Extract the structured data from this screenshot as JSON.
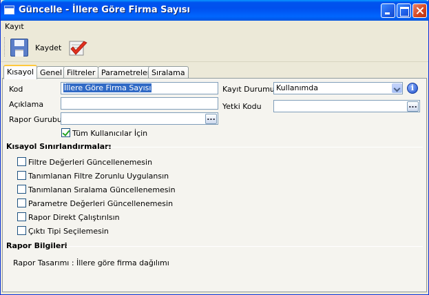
{
  "window": {
    "title": "Güncelle - İllere Göre Firma Sayısı"
  },
  "menu": {
    "items": [
      "Kayıt"
    ]
  },
  "toolbar": {
    "save_label": "Kaydet"
  },
  "tabs": [
    "Kısayol",
    "Genel",
    "Filtreler",
    "Parametreler",
    "Sıralama"
  ],
  "active_tab": "Kısayol",
  "form": {
    "kod_label": "Kod",
    "kod_value": "İllere Göre Firma Sayısı",
    "aciklama_label": "Açıklama",
    "aciklama_value": "",
    "rapor_gurubu_label": "Rapor Gurubu",
    "rapor_gurubu_value": "",
    "tum_kullanicilar_label": "Tüm Kullanıcılar İçin",
    "tum_kullanicilar_checked": true,
    "kayit_durumu_label": "Kayıt Durumu",
    "kayit_durumu_value": "Kullanımda",
    "yetki_kodu_label": "Yetki Kodu",
    "yetki_kodu_value": "",
    "ellipsis": "..."
  },
  "restrictions": {
    "title": "Kısayol Sınırlandırmaları",
    "items": [
      {
        "label": "Filtre Değerleri Güncellenemesin",
        "checked": false
      },
      {
        "label": "Tanımlanan Filtre Zorunlu Uygulansın",
        "checked": false
      },
      {
        "label": "Tanımlanan Sıralama Güncellenemesin",
        "checked": false
      },
      {
        "label": "Parametre Değerleri Güncellenemesin",
        "checked": false
      },
      {
        "label": "Rapor Direkt Çalıştırılsın",
        "checked": false
      },
      {
        "label": "Çıktı Tipi Seçilemesin",
        "checked": false
      }
    ]
  },
  "report_info": {
    "title": "Rapor Bilgileri",
    "design_text": "Rapor Tasarımı : İllere göre firma dağılımı"
  },
  "colors": {
    "titlebar": "#0053ee",
    "selection": "#316ac5",
    "tab_highlight": "#ffc83c",
    "window_bg": "#ece9d8"
  }
}
